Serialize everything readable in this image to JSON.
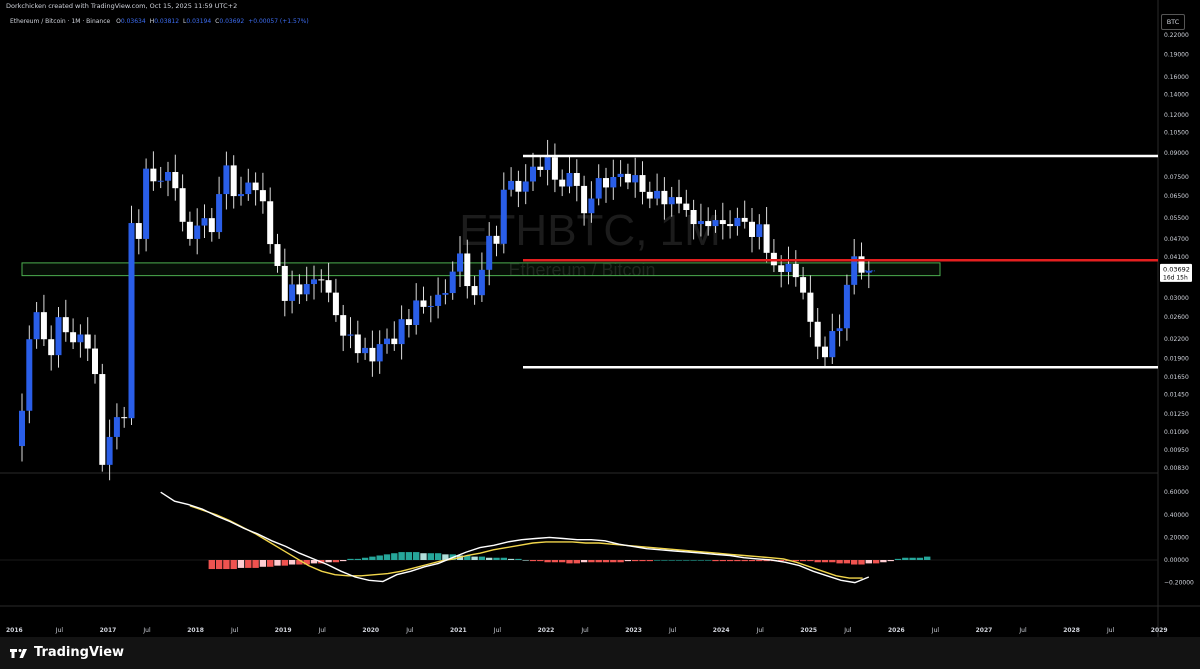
{
  "header": {
    "created_by": "Dorkchicken created with TradingView.com, Oct 15, 2025 11:59 UTC+2",
    "symbol": "Ethereum / Bitcoin · 1M · Binance",
    "ohlc": [
      {
        "k": "O",
        "v": "0.03634"
      },
      {
        "k": "H",
        "v": "0.03812"
      },
      {
        "k": "L",
        "v": "0.03194"
      },
      {
        "k": "C",
        "v": "0.03692"
      },
      {
        "k": "",
        "v": "+0.00057 (+1.57%)"
      }
    ]
  },
  "currency_tag": "BTC",
  "watermark": {
    "ticker": "ETHBTC, 1M",
    "name": "Ethereum / Bitcoin"
  },
  "price_axis": {
    "labels": [
      {
        "t": "0.22000",
        "v": 0.22
      },
      {
        "t": "0.19000",
        "v": 0.19
      },
      {
        "t": "0.16000",
        "v": 0.16
      },
      {
        "t": "0.14000",
        "v": 0.14
      },
      {
        "t": "0.12000",
        "v": 0.12
      },
      {
        "t": "0.10500",
        "v": 0.105
      },
      {
        "t": "0.09000",
        "v": 0.09
      },
      {
        "t": "0.07500",
        "v": 0.075
      },
      {
        "t": "0.06500",
        "v": 0.065
      },
      {
        "t": "0.05500",
        "v": 0.055
      },
      {
        "t": "0.04700",
        "v": 0.047
      },
      {
        "t": "0.04100",
        "v": 0.041
      },
      {
        "t": "0.03000",
        "v": 0.03
      },
      {
        "t": "0.02600",
        "v": 0.026
      },
      {
        "t": "0.02200",
        "v": 0.022
      },
      {
        "t": "0.01900",
        "v": 0.019
      },
      {
        "t": "0.01650",
        "v": 0.0165
      },
      {
        "t": "0.01450",
        "v": 0.0145
      },
      {
        "t": "0.01250",
        "v": 0.0125
      },
      {
        "t": "0.01090",
        "v": 0.0109
      },
      {
        "t": "0.00950",
        "v": 0.0095
      },
      {
        "t": "0.00830",
        "v": 0.0083
      }
    ],
    "current_price": "0.03692",
    "countdown": "16d 15h"
  },
  "osc_axis": {
    "labels": [
      {
        "t": "0.60000",
        "v": 0.6
      },
      {
        "t": "0.40000",
        "v": 0.4
      },
      {
        "t": "0.20000",
        "v": 0.2
      },
      {
        "t": "0.00000",
        "v": 0.0
      },
      {
        "t": "−0.20000",
        "v": -0.2
      }
    ]
  },
  "time_axis": {
    "labels": [
      {
        "t": "2016",
        "m": 0,
        "bold": true
      },
      {
        "t": "Jul",
        "m": 6
      },
      {
        "t": "2017",
        "m": 12,
        "bold": true
      },
      {
        "t": "Jul",
        "m": 18
      },
      {
        "t": "2018",
        "m": 24,
        "bold": true
      },
      {
        "t": "Jul",
        "m": 30
      },
      {
        "t": "2019",
        "m": 36,
        "bold": true
      },
      {
        "t": "Jul",
        "m": 42
      },
      {
        "t": "2020",
        "m": 48,
        "bold": true
      },
      {
        "t": "Jul",
        "m": 54
      },
      {
        "t": "2021",
        "m": 60,
        "bold": true
      },
      {
        "t": "Jul",
        "m": 66
      },
      {
        "t": "2022",
        "m": 72,
        "bold": true
      },
      {
        "t": "Jul",
        "m": 78
      },
      {
        "t": "2023",
        "m": 84,
        "bold": true
      },
      {
        "t": "Jul",
        "m": 90
      },
      {
        "t": "2024",
        "m": 96,
        "bold": true
      },
      {
        "t": "Jul",
        "m": 102
      },
      {
        "t": "2025",
        "m": 108,
        "bold": true
      },
      {
        "t": "Jul",
        "m": 114
      },
      {
        "t": "2026",
        "m": 120,
        "bold": true
      },
      {
        "t": "Jul",
        "m": 126
      },
      {
        "t": "2027",
        "m": 132,
        "bold": true
      },
      {
        "t": "Jul",
        "m": 138
      },
      {
        "t": "2028",
        "m": 144,
        "bold": true
      },
      {
        "t": "Jul",
        "m": 150
      },
      {
        "t": "2029",
        "m": 156,
        "bold": true
      }
    ]
  },
  "levels": {
    "top_line": 0.088,
    "bottom_line": 0.0178,
    "red_line": 0.04,
    "zone_high": 0.0392,
    "zone_low": 0.0356
  },
  "colors": {
    "up": "#2a5ee8",
    "down": "#ffffff",
    "red_line": "#e41f1f",
    "zone_border": "#4caf50",
    "hist_pos_strong": "#26a69a",
    "hist_pos_light": "#b2dfdb",
    "hist_neg_strong": "#ef5350",
    "hist_neg_light": "#ffcdd2",
    "macd_line": "#ffffff",
    "signal_line": "#f2d64b"
  },
  "footer": {
    "logo_text": "TradingView"
  },
  "chart_data": {
    "type": "candlestick",
    "interval": "1M",
    "start": "2016-01",
    "close": [
      0.0128,
      0.022,
      0.027,
      0.022,
      0.0195,
      0.026,
      0.0232,
      0.0215,
      0.0228,
      0.0205,
      0.0169,
      0.0085,
      0.0105,
      0.0122,
      0.0121,
      0.053,
      0.047,
      0.08,
      0.0727,
      0.073,
      0.078,
      0.069,
      0.0535,
      0.047,
      0.052,
      0.055,
      0.0495,
      0.066,
      0.082,
      0.065,
      0.066,
      0.072,
      0.068,
      0.0625,
      0.0452,
      0.0383,
      0.0294,
      0.0333,
      0.0309,
      0.0334,
      0.0346,
      0.0344,
      0.0313,
      0.0264,
      0.0226,
      0.0228,
      0.0198,
      0.0206,
      0.0186,
      0.0212,
      0.0221,
      0.0212,
      0.0256,
      0.0245,
      0.0295,
      0.0281,
      0.0283,
      0.0308,
      0.0312,
      0.0367,
      0.0421,
      0.0329,
      0.0307,
      0.0372,
      0.0481,
      0.0453,
      0.0682,
      0.0729,
      0.0672,
      0.0726,
      0.0812,
      0.0792,
      0.0872,
      0.0736,
      0.0699,
      0.0774,
      0.0702,
      0.0571,
      0.0638,
      0.0745,
      0.0694,
      0.0751,
      0.0769,
      0.0721,
      0.0762,
      0.0671,
      0.0638,
      0.0676,
      0.0611,
      0.0645,
      0.0614,
      0.0585,
      0.0526,
      0.0538,
      0.0518,
      0.0542,
      0.0526,
      0.0518,
      0.0551,
      0.0535,
      0.0477,
      0.0525,
      0.0423,
      0.0385,
      0.0366,
      0.0389,
      0.0352,
      0.0313,
      0.0251,
      0.0208,
      0.0192,
      0.0234,
      0.0239,
      0.0332,
      0.0412,
      0.0364,
      0.0369
    ],
    "open_first": 0.0098,
    "high_ratio": 1.14,
    "low_ratio": 0.89,
    "macd": [
      0.6,
      0.52,
      0.49,
      0.45,
      0.39,
      0.34,
      0.28,
      0.23,
      0.17,
      0.12,
      0.06,
      0.01,
      -0.04,
      -0.1,
      -0.15,
      -0.18,
      -0.19,
      -0.13,
      -0.1,
      -0.06,
      -0.03,
      0.02,
      0.07,
      0.11,
      0.13,
      0.16,
      0.18,
      0.19,
      0.2,
      0.19,
      0.18,
      0.18,
      0.17,
      0.14,
      0.12,
      0.1,
      0.09,
      0.08,
      0.07,
      0.06,
      0.05,
      0.04,
      0.02,
      0.01,
      0.0,
      -0.02,
      -0.05,
      -0.1,
      -0.14,
      -0.18,
      -0.2,
      -0.15
    ],
    "signal": [
      0.48,
      0.44,
      0.4,
      0.35,
      0.29,
      0.23,
      0.16,
      0.09,
      0.02,
      -0.05,
      -0.1,
      -0.13,
      -0.14,
      -0.14,
      -0.13,
      -0.12,
      -0.1,
      -0.07,
      -0.04,
      -0.01,
      0.01,
      0.04,
      0.06,
      0.09,
      0.11,
      0.13,
      0.15,
      0.16,
      0.16,
      0.16,
      0.15,
      0.15,
      0.14,
      0.13,
      0.12,
      0.11,
      0.1,
      0.09,
      0.08,
      0.07,
      0.06,
      0.05,
      0.04,
      0.03,
      0.02,
      0.01,
      -0.02,
      -0.06,
      -0.1,
      -0.14,
      -0.16,
      -0.16
    ],
    "hist": [
      -0.08,
      -0.08,
      -0.08,
      -0.08,
      -0.07,
      -0.07,
      -0.07,
      -0.06,
      -0.06,
      -0.05,
      -0.05,
      -0.04,
      -0.04,
      -0.04,
      -0.03,
      -0.03,
      -0.02,
      -0.02,
      -0.01,
      0.01,
      0.01,
      0.02,
      0.03,
      0.04,
      0.05,
      0.06,
      0.07,
      0.07,
      0.07,
      0.06,
      0.06,
      0.06,
      0.05,
      0.05,
      0.04,
      0.04,
      0.03,
      0.03,
      0.02,
      0.02,
      0.02,
      0.01,
      0.01,
      0.0,
      -0.01,
      -0.01,
      -0.02,
      -0.02,
      -0.02,
      -0.03,
      -0.03,
      -0.02,
      -0.02,
      -0.02,
      -0.02,
      -0.02,
      -0.02,
      -0.01,
      -0.01,
      -0.01,
      -0.01,
      0.0,
      0.0,
      0.0,
      0.0,
      0.0,
      0.0,
      0.0,
      0.0,
      -0.01,
      -0.01,
      -0.01,
      -0.01,
      -0.01,
      -0.01,
      -0.01,
      -0.01,
      -0.01,
      -0.01,
      -0.01,
      -0.01,
      -0.01,
      -0.01,
      -0.02,
      -0.02,
      -0.02,
      -0.03,
      -0.03,
      -0.04,
      -0.04,
      -0.03,
      -0.03,
      -0.02,
      -0.01,
      0.01,
      0.02,
      0.02,
      0.02,
      0.03
    ],
    "ylim": [
      0.0083,
      0.22
    ],
    "log_scale": true,
    "grid": false
  }
}
